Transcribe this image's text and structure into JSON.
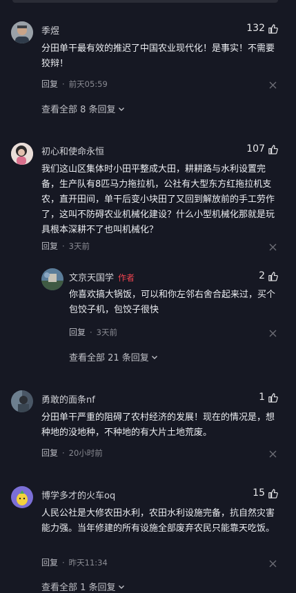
{
  "comments": [
    {
      "user": "季煜",
      "likes": "132",
      "text": "分田单干最有效的推迟了中国农业现代化！是事实！不需要狡辩！",
      "reply_label": "回复",
      "time": "前天05:59",
      "view_all": "查看全部 8 条回复"
    },
    {
      "user": "初心和使命永恒",
      "likes": "107",
      "text": "我们这山区集体时小田平整成大田，耕耕路与水利设置完备，生产队有8匹马力拖拉机，公社有大型东方红拖拉机支农，直开田间，单干后变小块田了又回到解放前的手工劳作了，这叫不防碍农业机械化建设？什么小型机械化那就是玩具根本深耕不了也叫机械化？",
      "reply_label": "回复",
      "time": "3天前",
      "reply": {
        "user": "文京天国学",
        "badge": "作者",
        "likes": "2",
        "text": "你喜欢搞大锅饭，可以和你左邻右舍合起来过，买个包饺子机，包饺子很快",
        "reply_label": "回复",
        "time": "3天前"
      },
      "view_all": "查看全部 21 条回复"
    },
    {
      "user": "勇敢的面条nf",
      "likes": "1",
      "text": "分田单干严重的阻碍了农村经济的发展！现在的情况是，想种地的没地种，不种地的有大片土地荒废。",
      "reply_label": "回复",
      "time": "20小时前"
    },
    {
      "user": "博学多才的火车oq",
      "likes": "15",
      "text": "人民公社是大修农田水利，农田水利设施完备，抗自然灾害能力强。当年修建的所有设施全部废弃农民只能靠天吃饭。",
      "reply_label": "回复",
      "time": "昨天11:34",
      "view_all": "查看全部 1 条回复"
    }
  ],
  "icons": {
    "like": "thumbs-up-icon",
    "close": "close-icon",
    "expand": "chevron-down-icon"
  }
}
